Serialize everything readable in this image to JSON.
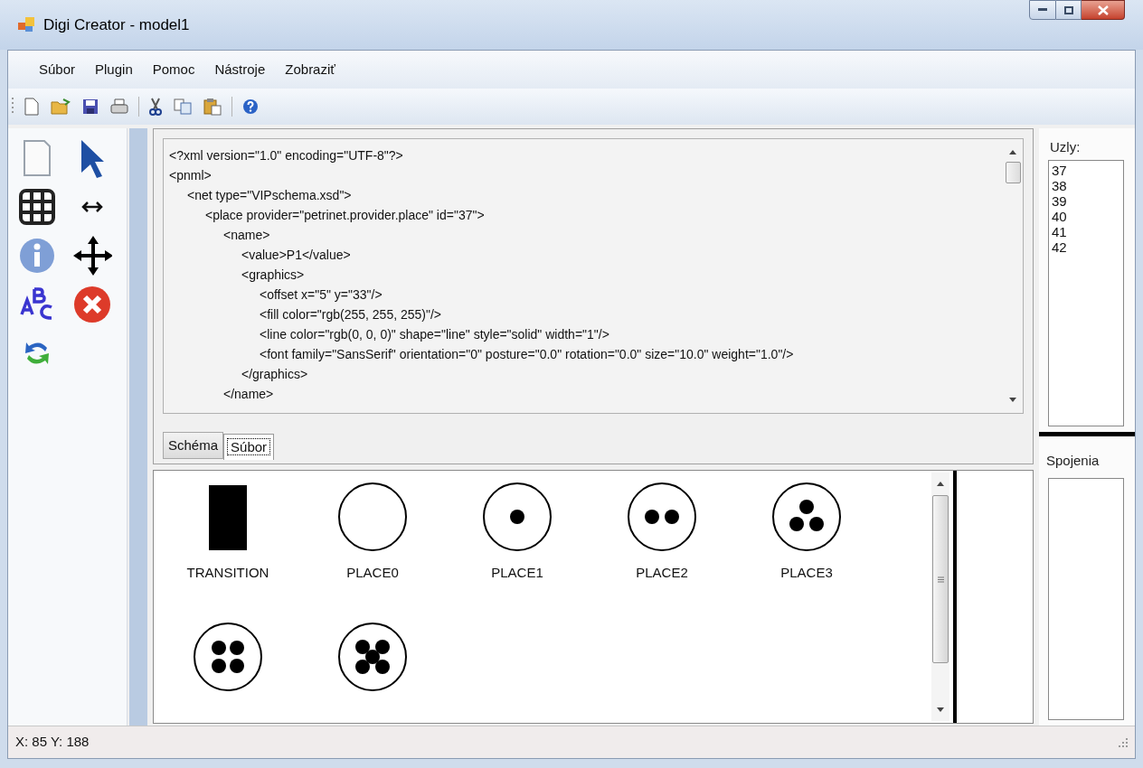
{
  "window": {
    "title": "Digi Creator - model1"
  },
  "menu": [
    "Súbor",
    "Plugin",
    "Pomoc",
    "Nástroje",
    "Zobraziť"
  ],
  "xml_view": {
    "lines": [
      {
        "text": "<?xml version=\"1.0\" encoding=\"UTF-8\"?>"
      },
      {
        "text": "<pnml>",
        "children": [
          {
            "text": "<net type=\"VIPschema.xsd\">",
            "children": [
              {
                "text": "<place provider=\"petrinet.provider.place\" id=\"37\">",
                "children": [
                  {
                    "text": "<name>",
                    "children": [
                      {
                        "text": "<value>P1</value>"
                      },
                      {
                        "text": "<graphics>",
                        "children": [
                          {
                            "text": "<offset x=\"5\" y=\"33\"/>"
                          },
                          {
                            "text": "<fill color=\"rgb(255, 255, 255)\"/>"
                          },
                          {
                            "text": "<line color=\"rgb(0, 0, 0)\" shape=\"line\" style=\"solid\" width=\"1\"/>"
                          },
                          {
                            "text": "<font family=\"SansSerif\" orientation=\"0\" posture=\"0.0\" rotation=\"0.0\" size=\"10.0\" weight=\"1.0\"/>"
                          }
                        ]
                      },
                      {
                        "text": "</graphics>"
                      }
                    ]
                  },
                  {
                    "text": "</name>"
                  }
                ]
              }
            ]
          }
        ]
      }
    ]
  },
  "tabs": [
    {
      "label": "Schéma",
      "selected": false
    },
    {
      "label": "Súbor",
      "selected": true
    }
  ],
  "palette": [
    {
      "kind": "transition",
      "label": "TRANSITION"
    },
    {
      "kind": "place0",
      "label": "PLACE0"
    },
    {
      "kind": "place1",
      "label": "PLACE1"
    },
    {
      "kind": "place2",
      "label": "PLACE2"
    },
    {
      "kind": "place3",
      "label": "PLACE3"
    },
    {
      "kind": "place4"
    },
    {
      "kind": "place5"
    }
  ],
  "nodes_panel": {
    "label": "Uzly:",
    "items": [
      "37",
      "38",
      "39",
      "40",
      "41",
      "42"
    ]
  },
  "connections_panel": {
    "label": "Spojenia"
  },
  "status_bar": {
    "text": "X: 85 Y: 188"
  }
}
